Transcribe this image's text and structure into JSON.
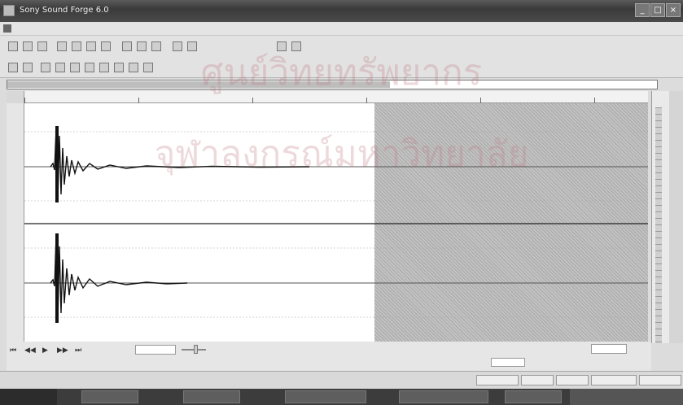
{
  "window": {
    "title": "Sony Sound Forge 6.0",
    "minimize_label": "_",
    "maximize_label": "□",
    "close_label": "×"
  },
  "menubar": {
    "items": [
      "",
      "",
      "",
      "",
      "",
      "",
      "",
      "",
      "",
      "",
      "",
      ""
    ]
  },
  "ruler": {
    "marks": [
      "",
      "",
      "",
      "",
      "",
      ""
    ]
  },
  "amplitude_ruler": {
    "marks": [
      "",
      "",
      "",
      "",
      "",
      ""
    ]
  },
  "waveform": {
    "channels": 2,
    "selection_start_fraction": 0.56
  },
  "transport": {
    "zoom_label": "",
    "zoom_value": "",
    "selection_value": "",
    "zoom_ratio": ""
  },
  "statusbar": {
    "fields": [
      "",
      "",
      "",
      "",
      ""
    ]
  },
  "taskbar": {
    "start_label": "",
    "tasks": [
      "",
      "",
      "",
      "",
      ""
    ]
  },
  "watermark": {
    "line1": "ศูนย์วิทยทรัพยากร",
    "line2": "จุฬาลงกรณ์มหาวิทยาลัย"
  },
  "colors": {
    "titlebar": "#4a4a4a",
    "waveform": "#111111",
    "selection": "#b5b5b5"
  }
}
